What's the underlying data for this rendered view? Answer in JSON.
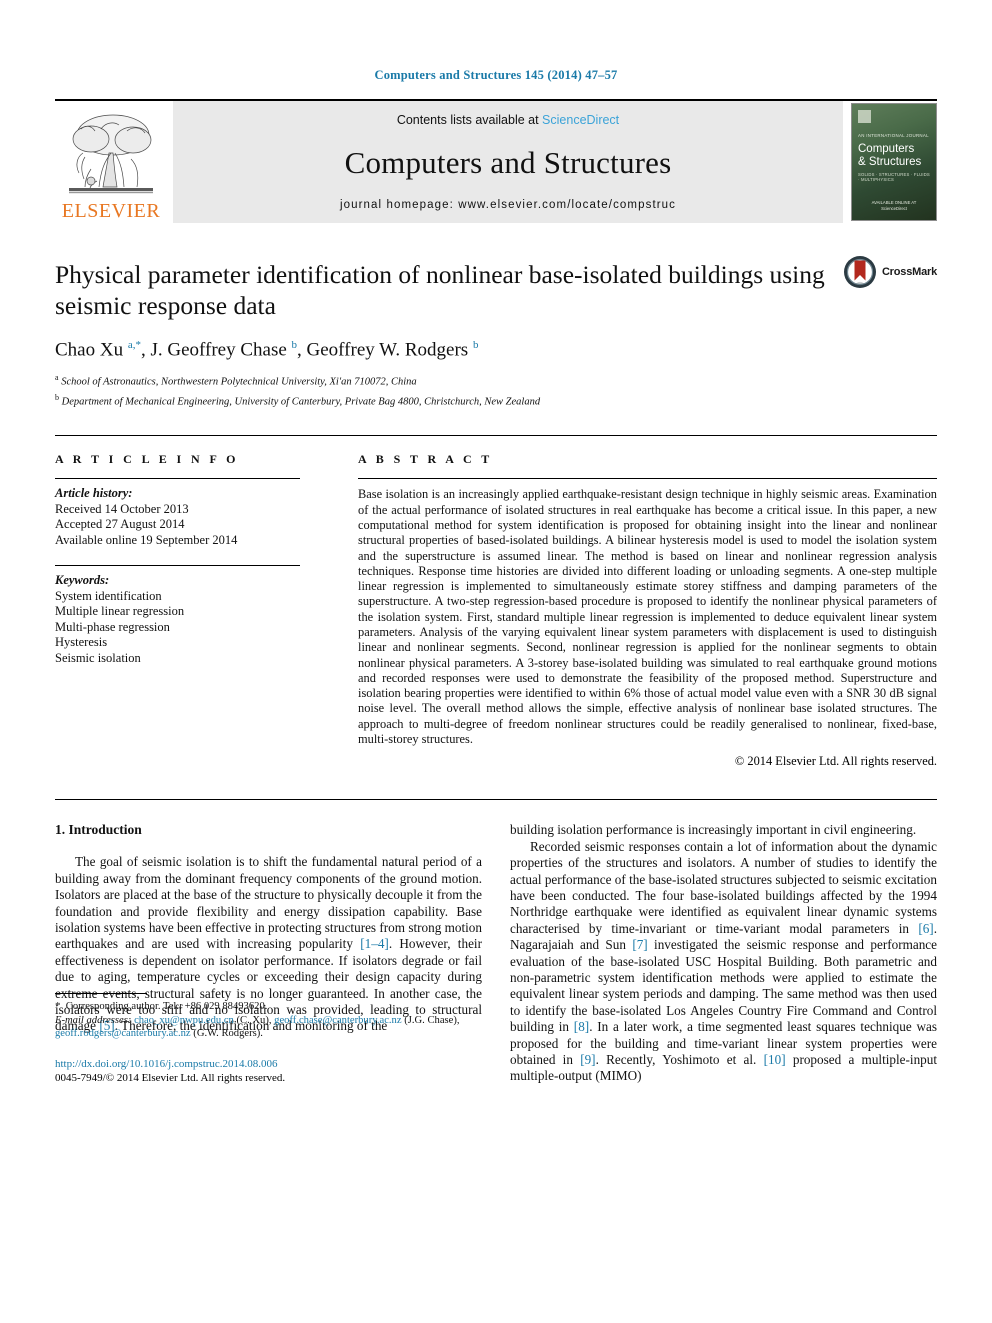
{
  "running_head": "Computers and Structures 145 (2014) 47–57",
  "masthead": {
    "publisher": "ELSEVIER",
    "contents_prefix": "Contents lists available at ",
    "sciencedirect": "ScienceDirect",
    "journal_name": "Computers and Structures",
    "homepage": "journal homepage: www.elsevier.com/locate/compstruc",
    "cover": {
      "sub_top": "AN INTERNATIONAL JOURNAL",
      "line1": "Computers",
      "line2": "& Structures",
      "sub_bottom": "SOLIDS · STRUCTURES · FLUIDS · MULTIPHYSICS",
      "foot1": "AVAILABLE ONLINE AT",
      "foot2": "ScienceDirect"
    }
  },
  "article": {
    "title": "Physical parameter identification of nonlinear base-isolated buildings using seismic response data",
    "crossmark_label": "CrossMark",
    "authors_html": "Chao Xu <sup>a,*</sup>, J. Geoffrey Chase <sup>b</sup>, Geoffrey W. Rodgers <sup>b</sup>",
    "affiliations": [
      "School of Astronautics, Northwestern Polytechnical University, Xi'an 710072, China",
      "Department of Mechanical Engineering, University of Canterbury, Private Bag 4800, Christchurch, New Zealand"
    ]
  },
  "info": {
    "heading": "A R T I C L E   I N F O",
    "history_label": "Article history:",
    "history": [
      "Received 14 October 2013",
      "Accepted 27 August 2014",
      "Available online 19 September 2014"
    ],
    "keywords_label": "Keywords:",
    "keywords": [
      "System identification",
      "Multiple linear regression",
      "Multi-phase regression",
      "Hysteresis",
      "Seismic isolation"
    ]
  },
  "abstract": {
    "heading": "A B S T R A C T",
    "text": "Base isolation is an increasingly applied earthquake-resistant design technique in highly seismic areas. Examination of the actual performance of isolated structures in real earthquake has become a critical issue. In this paper, a new computational method for system identification is proposed for obtaining insight into the linear and nonlinear structural properties of based-isolated buildings. A bilinear hysteresis model is used to model the isolation system and the superstructure is assumed linear. The method is based on linear and nonlinear regression analysis techniques. Response time histories are divided into different loading or unloading segments. A one-step multiple linear regression is implemented to simultaneously estimate storey stiffness and damping parameters of the superstructure. A two-step regression-based procedure is proposed to identify the nonlinear physical parameters of the isolation system. First, standard multiple linear regression is implemented to deduce equivalent linear system parameters. Analysis of the varying equivalent linear system parameters with displacement is used to distinguish linear and nonlinear segments. Second, nonlinear regression is applied for the nonlinear segments to obtain nonlinear physical parameters. A 3-storey base-isolated building was simulated to real earthquake ground motions and recorded responses were used to demonstrate the feasibility of the proposed method. Superstructure and isolation bearing properties were identified to within 6% those of actual model value even with a SNR 30 dB signal noise level. The overall method allows the simple, effective analysis of nonlinear base isolated structures. The approach to multi-degree of freedom nonlinear structures could be readily generalised to nonlinear, fixed-base, multi-storey structures.",
    "copyright": "© 2014 Elsevier Ltd. All rights reserved."
  },
  "body": {
    "section_heading": "1. Introduction",
    "left_paragraphs_html": [
      "The goal of seismic isolation is to shift the fundamental natural period of a building away from the dominant frequency components of the ground motion. Isolators are placed at the base of the structure to physically decouple it from the foundation and provide flexibility and energy dissipation capability. Base isolation systems have been effective in protecting structures from strong motion earthquakes and are used with increasing popularity <span class=\"ref\">[1–4]</span>. However, their effectiveness is dependent on isolator performance. If isolators degrade or fail due to aging, temperature cycles or exceeding their design capacity during extreme events, structural safety is no longer guaranteed. In another case, the isolators were too stiff and no isolation was provided, leading to structural damage <span class=\"ref\">[5]</span>. Therefore, the identification and monitoring of the"
    ],
    "right_paragraphs_html": [
      "building isolation performance is increasingly important in civil engineering.",
      "Recorded seismic responses contain a lot of information about the dynamic properties of the structures and isolators. A number of studies to identify the actual performance of the base-isolated structures subjected to seismic excitation have been conducted. The four base-isolated buildings affected by the 1994 Northridge earthquake were identified as equivalent linear dynamic systems characterised by time-invariant or time-variant modal parameters in <span class=\"ref\">[6]</span>. Nagarajaiah and Sun <span class=\"ref\">[7]</span> investigated the seismic response and performance evaluation of the base-isolated USC Hospital Building. Both parametric and non-parametric system identification methods were applied to estimate the equivalent linear system periods and damping. The same method was then used to identify the base-isolated Los Angeles Country Fire Command and Control building in <span class=\"ref\">[8]</span>. In a later work, a time segmented least squares technique was proposed for the building and time-variant linear system properties were obtained in <span class=\"ref\">[9]</span>. Recently, Yoshimoto et al. <span class=\"ref\">[10]</span> proposed a multiple-input multiple-output (MIMO)"
    ]
  },
  "footnote": {
    "corresponding_html": "<span style=\"font-size:11px\">*</span>&nbsp; Corresponding author. Tel.: +86 029 88493620.",
    "emails_html": "<span class=\"lbl\">E-mail addresses:</span> <span class=\"link\">chao_xu@nwpu.edu.cn</span> (C. Xu), <span class=\"link\">geoff.chase@canterbury.ac.nz</span> (J.G. Chase), <span class=\"link\">geoff.rodgers@canterbury.ac.nz</span> (G.W. Rodgers).",
    "doi": "http://dx.doi.org/10.1016/j.compstruc.2014.08.006",
    "issn_line": "0045-7949/© 2014 Elsevier Ltd. All rights reserved."
  },
  "colors": {
    "link": "#1a7aa8",
    "sciencedirect": "#3ba3d8",
    "elsevier_orange": "#E87722",
    "band_gray": "#e9e9e9"
  }
}
